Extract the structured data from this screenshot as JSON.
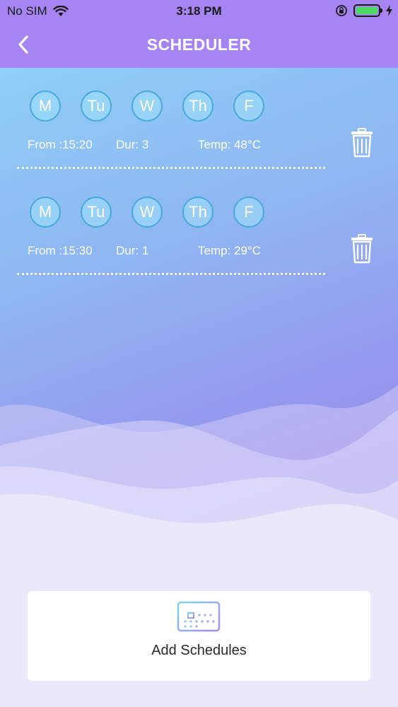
{
  "status": {
    "carrier": "No SIM",
    "time": "3:18 PM"
  },
  "nav": {
    "title": "SCHEDULER"
  },
  "schedules": [
    {
      "days": [
        "M",
        "Tu",
        "W",
        "Th",
        "F"
      ],
      "from": "From :15:20",
      "dur": "Dur:  3",
      "temp": "Temp: 48°C"
    },
    {
      "days": [
        "M",
        "Tu",
        "W",
        "Th",
        "F"
      ],
      "from": "From :15:30",
      "dur": "Dur:  1",
      "temp": "Temp: 29°C"
    }
  ],
  "add": {
    "label": "Add Schedules"
  },
  "colors": {
    "header": "#a684f2",
    "day_circle_border": "#46a8dc",
    "battery": "#4cd964"
  },
  "icons": {
    "back": "chevron-left-icon",
    "delete": "trash-icon",
    "add": "calendar-icon"
  }
}
